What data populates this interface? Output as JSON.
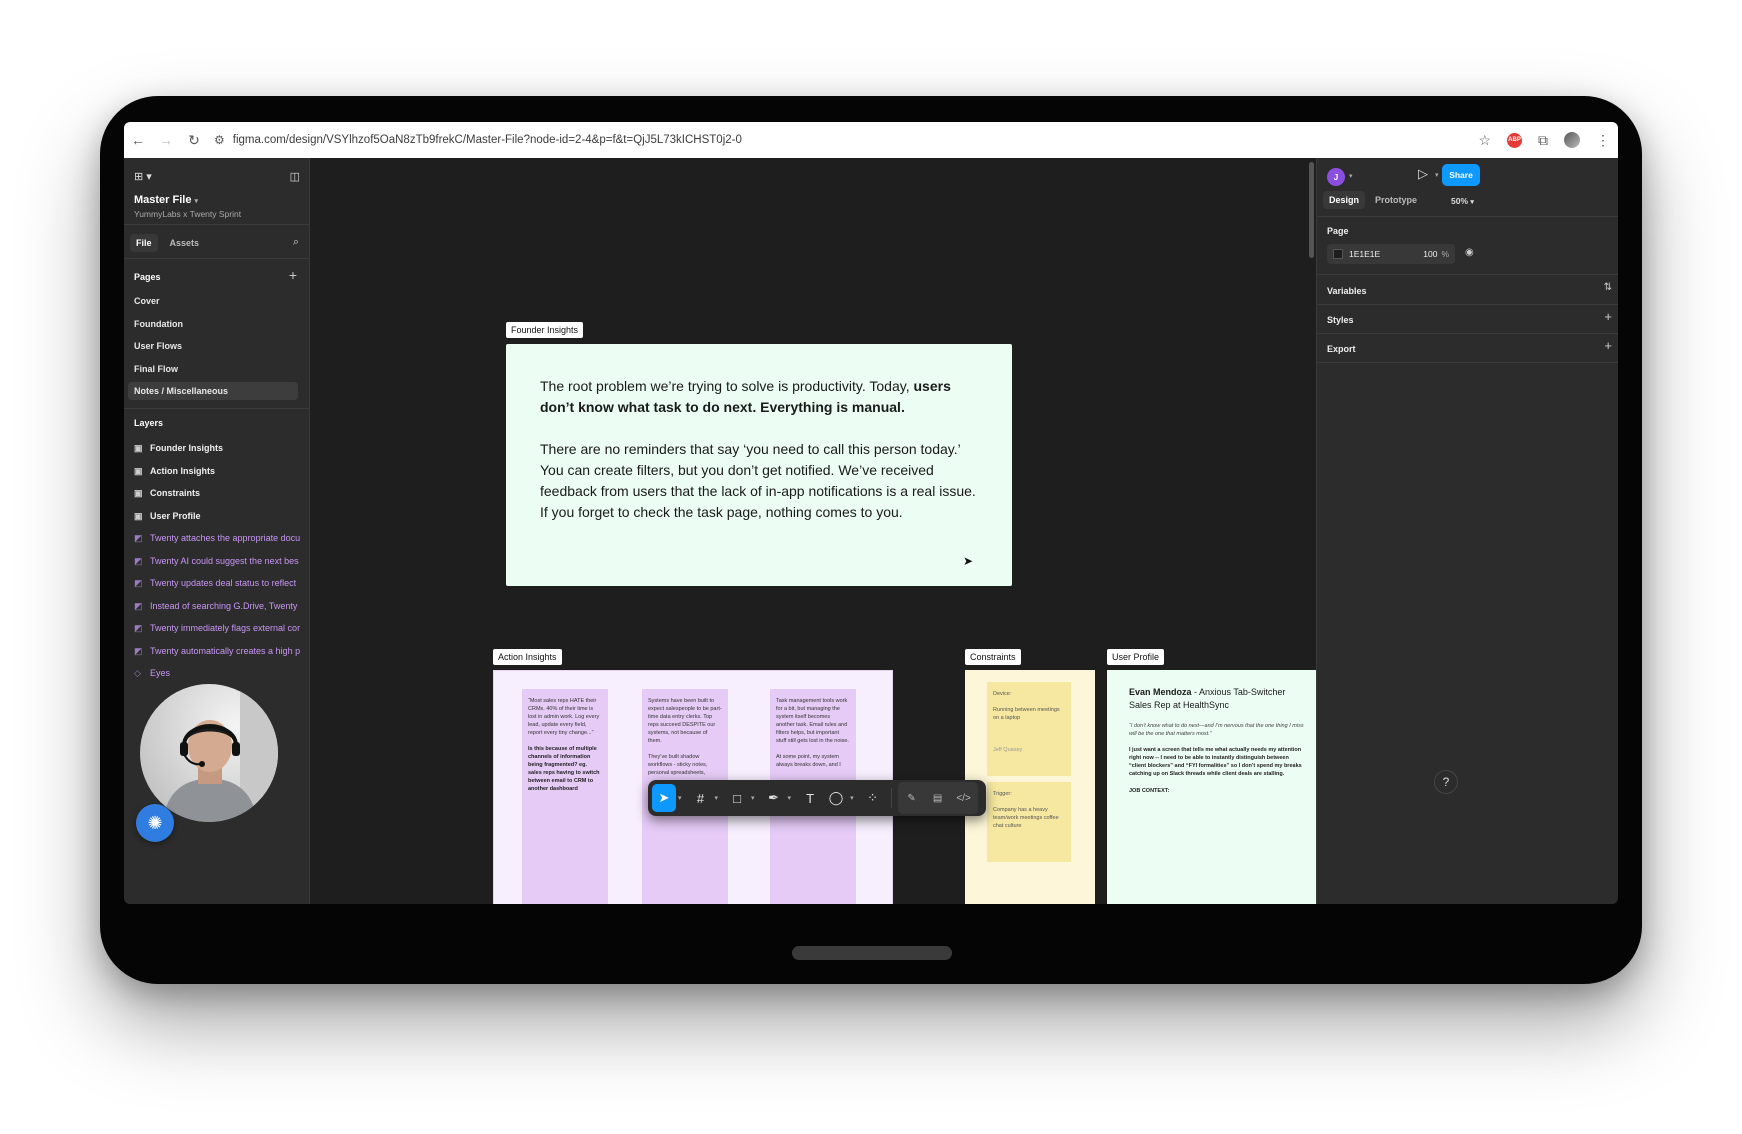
{
  "browser": {
    "url": "figma.com/design/VSYlhzof5OaN8zTb9frekC/Master-File?node-id=2-4&p=f&t=QjJ5L73kICHST0j2-0",
    "ext_badge": "ABP"
  },
  "left_panel": {
    "file_name": "Master File",
    "file_subtitle": "YummyLabs x Twenty Sprint",
    "tabs": [
      "File",
      "Assets"
    ],
    "pages_title": "Pages",
    "pages": [
      "Cover",
      "Foundation",
      "User Flows",
      "Final Flow",
      "Notes / Miscellaneous"
    ],
    "selected_page": "Notes / Miscellaneous",
    "layers_title": "Layers",
    "layers": [
      {
        "label": "Founder Insights",
        "kind": "frame"
      },
      {
        "label": "Action Insights",
        "kind": "frame"
      },
      {
        "label": "Constraints",
        "kind": "frame"
      },
      {
        "label": "User Profile",
        "kind": "frame"
      },
      {
        "label": "Twenty attaches the appropriate docu",
        "kind": "text"
      },
      {
        "label": "Twenty AI could suggest the next bes",
        "kind": "text"
      },
      {
        "label": "Twenty updates deal status to reflect",
        "kind": "text"
      },
      {
        "label": "Instead of searching G.Drive, Twenty",
        "kind": "text"
      },
      {
        "label": "Twenty immediately flags external cor",
        "kind": "text"
      },
      {
        "label": "Twenty automatically creates a high p",
        "kind": "text"
      },
      {
        "label": "Eyes",
        "kind": "component"
      }
    ]
  },
  "canvas": {
    "founder_label": "Founder Insights",
    "founder_p1_normal": "The root problem we’re trying to solve is productivity. Today, ",
    "founder_p1_bold": "users don’t know what task to do next. Everything is manual.",
    "founder_p2": "There are no reminders that say ‘you need to call this person today.’ You can create filters, but you don’t get notified. We’ve received feedback from users that the lack of in-app notifications is a real issue. If you forget to check the task page, nothing comes to you.",
    "action_label": "Action Insights",
    "action_notes": [
      {
        "text": "“Most sales reps HATE their CRMs. 40% of their time is lost in admin work. Log every lead, update every field, report every tiny change...”",
        "bold": "Is this because of multiple channels of information being fragmented? eg. sales reps having to switch between email to CRM to another dashboard"
      },
      {
        "text": "Systems have been built to expect salespeople to be part-time data entry clerks. Top reps succeed DESPITE our systems, not because of them.",
        "bold": "",
        "text2": "They’ve built shadow workflows - sticky notes, personal spreadsheets,"
      },
      {
        "text": "Task management tools work for a bit, but managing the system itself becomes another task. Email rules and filters helps, but important stuff still gets lost in the noise.",
        "bold": "",
        "text2": "At some point, my system always breaks down, and I"
      }
    ],
    "constraints_label": "Constraints",
    "constraints_notes": [
      {
        "title": "Device:",
        "body": "Running between meetings on a laptop",
        "foot": "Jeff Quasey"
      },
      {
        "title": "Trigger:",
        "body": "Company has a heavy team/work meetings coffee chat culture"
      }
    ],
    "profile_label": "User Profile",
    "profile_name": "Evan Mendoza",
    "profile_role": " - Anxious Tab-Switcher Sales Rep at HealthSync",
    "profile_quote": "“I don’t know what to do next—and I’m nervous that the one thing I miss will be the one that matters most.”",
    "profile_body": "I just want a screen that tells me what actually needs my attention right now -- I need to be able to instantly distinguish between “client blockers” and “FYI formalities” so I don’t spend my breaks catching up on Slack threads while client deals are stalling.",
    "profile_section": "JOB CONTEXT:"
  },
  "right_panel": {
    "avatar_initial": "J",
    "share_label": "Share",
    "tabs": [
      "Design",
      "Prototype"
    ],
    "zoom": "50%",
    "page_title": "Page",
    "page_color": "1E1E1E",
    "page_opacity": "100",
    "page_opacity_unit": "%",
    "variables_label": "Variables",
    "styles_label": "Styles",
    "export_label": "Export"
  },
  "help_label": "?"
}
